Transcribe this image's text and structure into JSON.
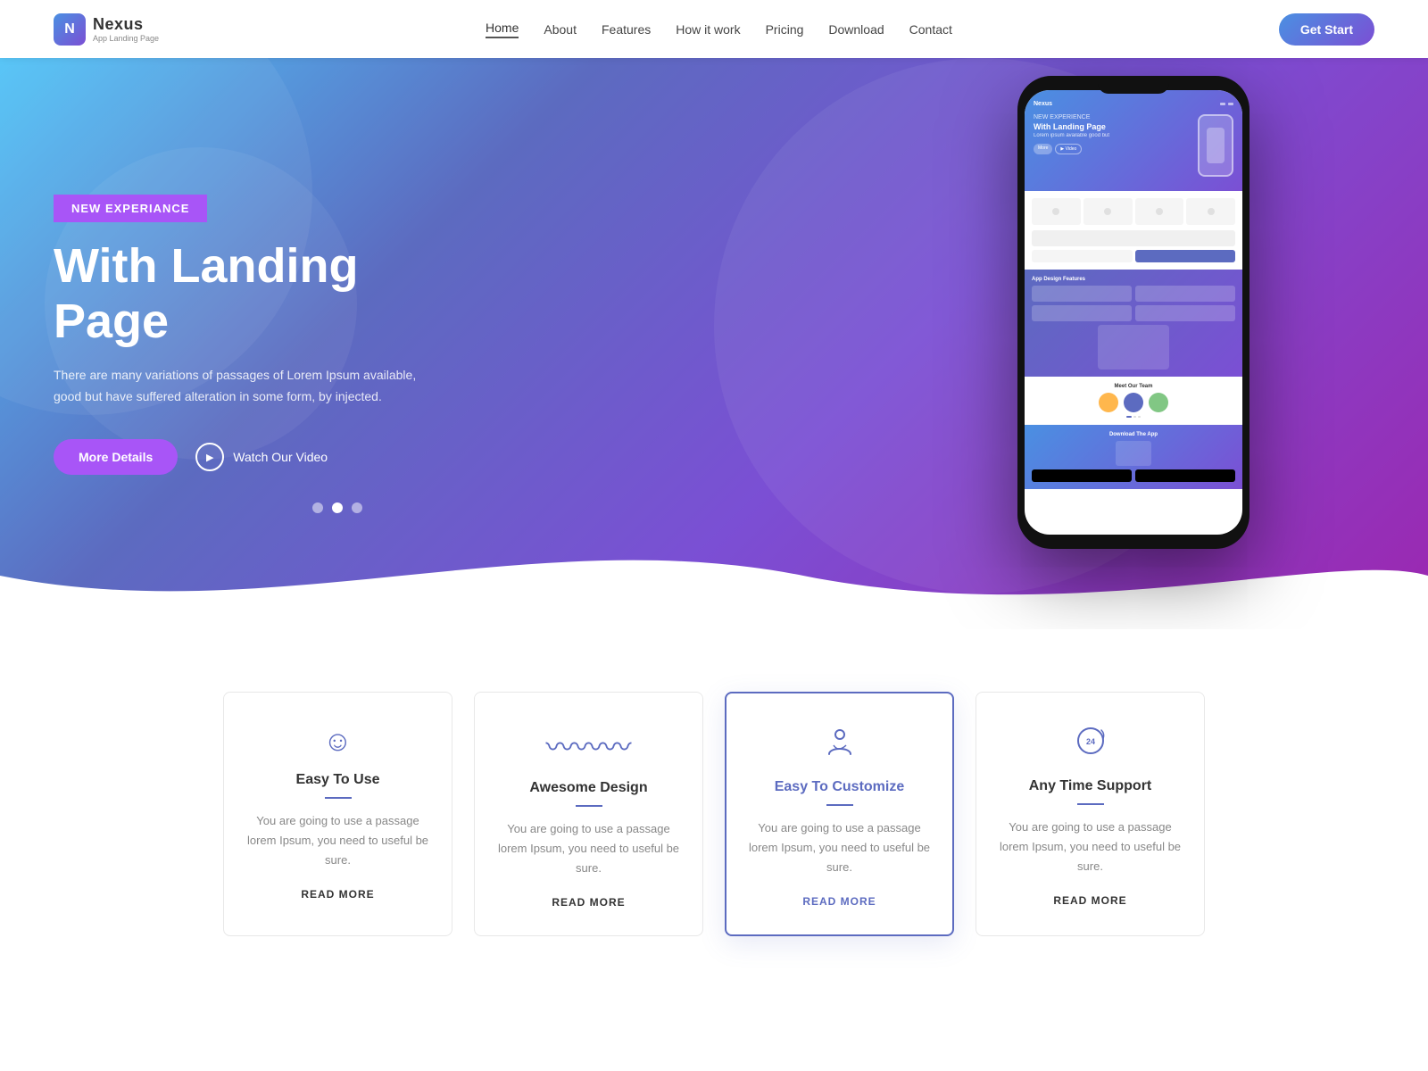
{
  "nav": {
    "logo_name": "Nexus",
    "logo_sub": "App Landing Page",
    "links": [
      {
        "label": "Home",
        "active": true
      },
      {
        "label": "About",
        "active": false
      },
      {
        "label": "Features",
        "active": false
      },
      {
        "label": "How it work",
        "active": false
      },
      {
        "label": "Pricing",
        "active": false
      },
      {
        "label": "Download",
        "active": false
      },
      {
        "label": "Contact",
        "active": false
      }
    ],
    "cta_label": "Get Start"
  },
  "hero": {
    "badge": "NEW EXPERIANCE",
    "title": "With Landing Page",
    "description": "There are many variations of passages of Lorem Ipsum available, good but have suffered alteration in some form, by injected.",
    "btn_more": "More Details",
    "btn_video": "Watch Our Video",
    "dots": [
      1,
      2,
      3
    ]
  },
  "features": {
    "cards": [
      {
        "icon": "☺",
        "title": "Easy To Use",
        "desc": "You are going to use a passage lorem Ipsum, you need to useful be sure.",
        "link": "READ MORE",
        "highlighted": false
      },
      {
        "icon": "≋",
        "title": "Awesome Design",
        "desc": "You are going to use a passage lorem Ipsum, you need to useful be sure.",
        "link": "READ MORE",
        "highlighted": false
      },
      {
        "icon": "✋",
        "title": "Easy To Customize",
        "desc": "You are going to use a passage lorem Ipsum, you need to useful be sure.",
        "link": "READ MORE",
        "highlighted": true
      },
      {
        "icon": "⟳",
        "title": "Any Time Support",
        "desc": "You are going to use a passage lorem Ipsum, you need to useful be sure.",
        "link": "READ MORE",
        "highlighted": false
      }
    ]
  }
}
